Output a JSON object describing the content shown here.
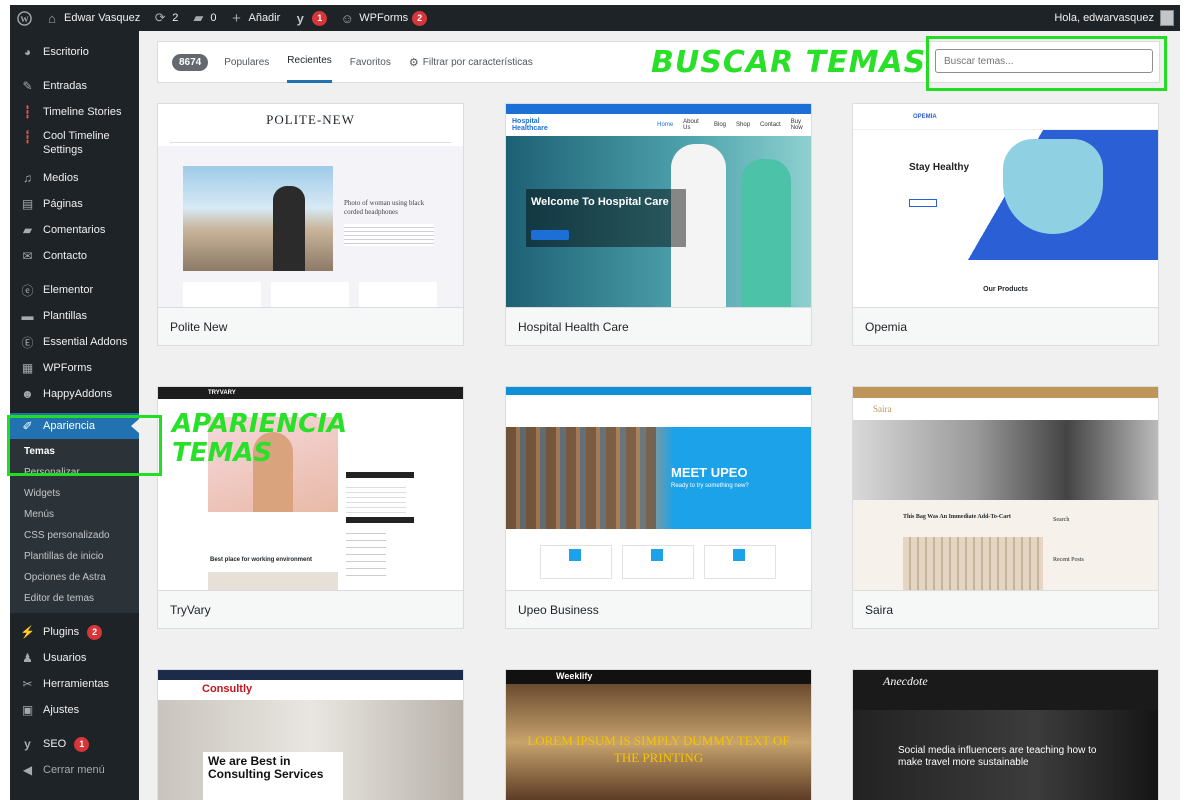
{
  "adminbar": {
    "site_name": "Edwar Vasquez",
    "updates_count": "2",
    "comments_count": "0",
    "new_label": "Añadir",
    "yoast_badge": "1",
    "wpforms_label": "WPForms",
    "wpforms_badge": "2",
    "greeting": "Hola, edwarvasquez"
  },
  "sidebar": {
    "items": [
      {
        "label": "Escritorio",
        "icon": "dashboard-icon"
      },
      {
        "label": "Entradas",
        "icon": "pin-icon"
      },
      {
        "label": "Timeline Stories",
        "icon": "timeline-icon"
      },
      {
        "label": "Cool Timeline Settings",
        "icon": "timeline-icon"
      },
      {
        "label": "Medios",
        "icon": "media-icon"
      },
      {
        "label": "Páginas",
        "icon": "pages-icon"
      },
      {
        "label": "Comentarios",
        "icon": "comments-icon"
      },
      {
        "label": "Contacto",
        "icon": "mail-icon"
      },
      {
        "label": "Elementor",
        "icon": "elementor-icon"
      },
      {
        "label": "Plantillas",
        "icon": "folder-icon"
      },
      {
        "label": "Essential Addons",
        "icon": "ea-icon"
      },
      {
        "label": "WPForms",
        "icon": "forms-icon"
      },
      {
        "label": "HappyAddons",
        "icon": "happy-icon"
      },
      {
        "label": "Apariencia",
        "icon": "brush-icon"
      },
      {
        "label": "Plugins",
        "icon": "plugin-icon",
        "badge": "2"
      },
      {
        "label": "Usuarios",
        "icon": "user-icon"
      },
      {
        "label": "Herramientas",
        "icon": "wrench-icon"
      },
      {
        "label": "Ajustes",
        "icon": "settings-icon"
      },
      {
        "label": "SEO",
        "icon": "yoast-icon",
        "badge": "1"
      },
      {
        "label": "Cerrar menú",
        "icon": "collapse-icon"
      }
    ],
    "submenu": [
      "Temas",
      "Personalizar",
      "Widgets",
      "Menús",
      "CSS personalizado",
      "Plantillas de inicio",
      "Opciones de Astra",
      "Editor de temas"
    ]
  },
  "filterbar": {
    "count": "8674",
    "tabs": [
      "Populares",
      "Recientes",
      "Favoritos"
    ],
    "feature_filter": "Filtrar por características",
    "search_placeholder": "Buscar temas..."
  },
  "annotations": {
    "buscar": "BUSCAR TEMAS",
    "apariencia_line1": "APARIENCIA",
    "apariencia_line2": "TEMAS"
  },
  "themes": [
    {
      "name": "Polite New",
      "shot_title": "POLITE-NEW",
      "shot_text": "Photo of woman using black corded headphones"
    },
    {
      "name": "Hospital Health Care",
      "shot_title": "Welcome To Hospital Care",
      "shot_brand": "Hospital Healthcare",
      "shot_nav": [
        "Home",
        "About Us",
        "Blog",
        "Shop",
        "Contact",
        "Buy Now"
      ]
    },
    {
      "name": "Opemia",
      "shot_title": "Stay Healthy",
      "shot_sub": "Our Products",
      "shot_brand": "OPEMIA"
    },
    {
      "name": "TryVary",
      "shot_title": "Best place for working environment",
      "shot_brand": "TRYVARY"
    },
    {
      "name": "Upeo Business",
      "shot_title": "MEET UPEO",
      "shot_sub": "Ready to try something new?"
    },
    {
      "name": "Saira",
      "shot_title": "This Bag Was An Immediate Add-To-Cart",
      "shot_brand": "Saira",
      "shot_side": "Search",
      "shot_side2": "Recent Posts"
    },
    {
      "name": "Consultly",
      "shot_brand": "Consultly",
      "shot_title": "We are Best in Consulting Services"
    },
    {
      "name": "Weeklify",
      "shot_brand": "Weeklify",
      "shot_title": "LOREM IPSUM IS SIMPLY DUMMY TEXT OF THE PRINTING"
    },
    {
      "name": "Anecdote",
      "shot_brand": "Anecdote",
      "shot_title": "Social media influencers are teaching how to make travel more sustainable"
    }
  ]
}
